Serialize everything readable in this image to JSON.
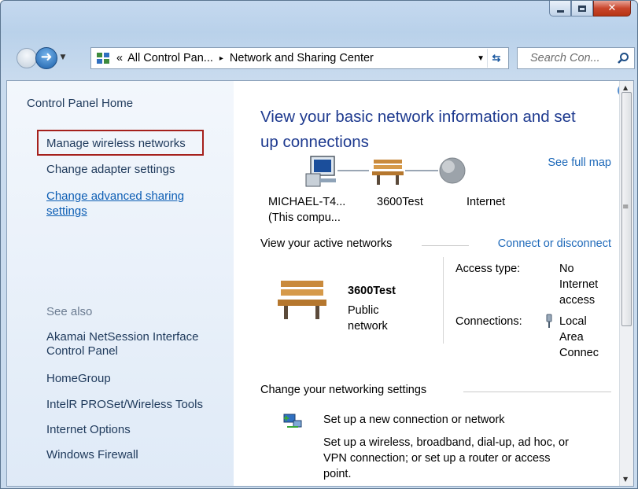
{
  "window": {
    "caption_buttons": [
      "minimize",
      "maximize",
      "close"
    ]
  },
  "navigation": {
    "breadcrumb_prefix": "«",
    "breadcrumb_1": "All Control Pan...",
    "breadcrumb_separator": "▸",
    "breadcrumb_2": "Network and Sharing Center",
    "search_placeholder": "Search Con..."
  },
  "sidebar": {
    "home": "Control Panel Home",
    "manage_wireless": "Manage wireless networks",
    "change_adapter": "Change adapter settings",
    "advanced_sharing_line1": "Change advanced sharing",
    "advanced_sharing_line2": "settings",
    "see_also": "See also",
    "akamai_line1": "Akamai NetSession Interface",
    "akamai_line2": "Control Panel",
    "homegroup": "HomeGroup",
    "intel": "IntelR PROSet/Wireless Tools",
    "internet_options": "Internet Options",
    "firewall": "Windows Firewall"
  },
  "main": {
    "title_line1": "View your basic network information and set",
    "title_line2": "up connections",
    "see_full_map": "See full map",
    "map": {
      "computer_line1": "MICHAEL-T4...",
      "computer_line2": "(This compu...",
      "network": "3600Test",
      "internet": "Internet"
    },
    "active_networks_heading": "View your active networks",
    "connect_disconnect": "Connect or disconnect",
    "active": {
      "name": "3600Test",
      "type_line1": "Public",
      "type_line2": "network",
      "access_type_label": "Access type:",
      "access_value_line1": "No",
      "access_value_line2": "Internet",
      "access_value_line3": "access",
      "connections_label": "Connections:",
      "connection_line1": "Local",
      "connection_line2": "Area",
      "connection_line3": "Connec"
    },
    "change_settings_heading": "Change your networking settings",
    "setup": {
      "link": "Set up a new connection or network",
      "desc_line1": "Set up a wireless, broadband, dial-up, ad hoc, or",
      "desc_line2": "VPN connection; or set up a router or access",
      "desc_line3": "point."
    }
  },
  "colors": {
    "link_blue": "#1e69b9",
    "title_blue": "#1e3a8f",
    "highlight_red": "#a5201c"
  }
}
